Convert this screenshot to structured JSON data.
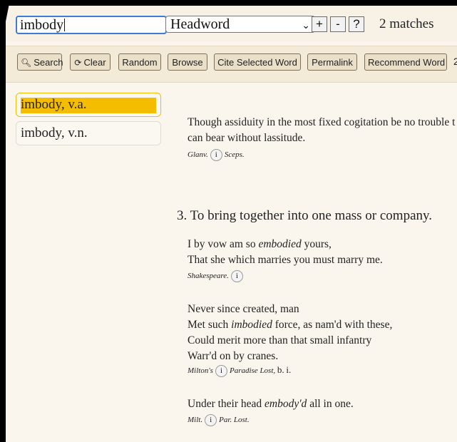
{
  "search": {
    "value": "imbody"
  },
  "field_select": {
    "selected": "Headword"
  },
  "mini_buttons": {
    "plus": "+",
    "minus": "-",
    "help": "?"
  },
  "matches_text": "2 matches",
  "toolbar": {
    "search": "Search",
    "clear": "Clear",
    "random": "Random",
    "browse": "Browse",
    "cite": "Cite Selected Word",
    "permalink": "Permalink",
    "recommend": "Recommend Word",
    "overflow": "2"
  },
  "results": [
    {
      "label": "imbody, v.a."
    },
    {
      "label": "imbody, v.n."
    }
  ],
  "entry": {
    "q1_line1": "Though assiduity in the most fixed cogitation be no trouble t",
    "q1_line2": "can bear without lassitude.",
    "q1_cite_a": "Glanv.",
    "q1_cite_b": "Sceps.",
    "sense3": "3. To bring together into one mass or company.",
    "q2_l1_pre": "I by vow am so ",
    "q2_l1_em": "embodied",
    "q2_l1_post": " yours,",
    "q2_l2": "That she which marries you must marry me.",
    "q2_cite": "Shakespeare.",
    "q3_l1": "Never since created, man",
    "q3_l2_pre": "Met such ",
    "q3_l2_em": "imbodied",
    "q3_l2_post": " force, as nam'd with these,",
    "q3_l3": "Could merit more than that small infantry",
    "q3_l4": "Warr'd on by cranes.",
    "q3_cite_a": "Milton's",
    "q3_cite_b": "Paradise Lost,",
    "q3_cite_c": "b.",
    "q3_cite_d": "i.",
    "q4_pre": "Under their head ",
    "q4_em": "embody'd",
    "q4_post": " all in one.",
    "q4_cite_a": "Milt.",
    "q4_cite_b": "Par. Lost.",
    "info_glyph": "i"
  }
}
